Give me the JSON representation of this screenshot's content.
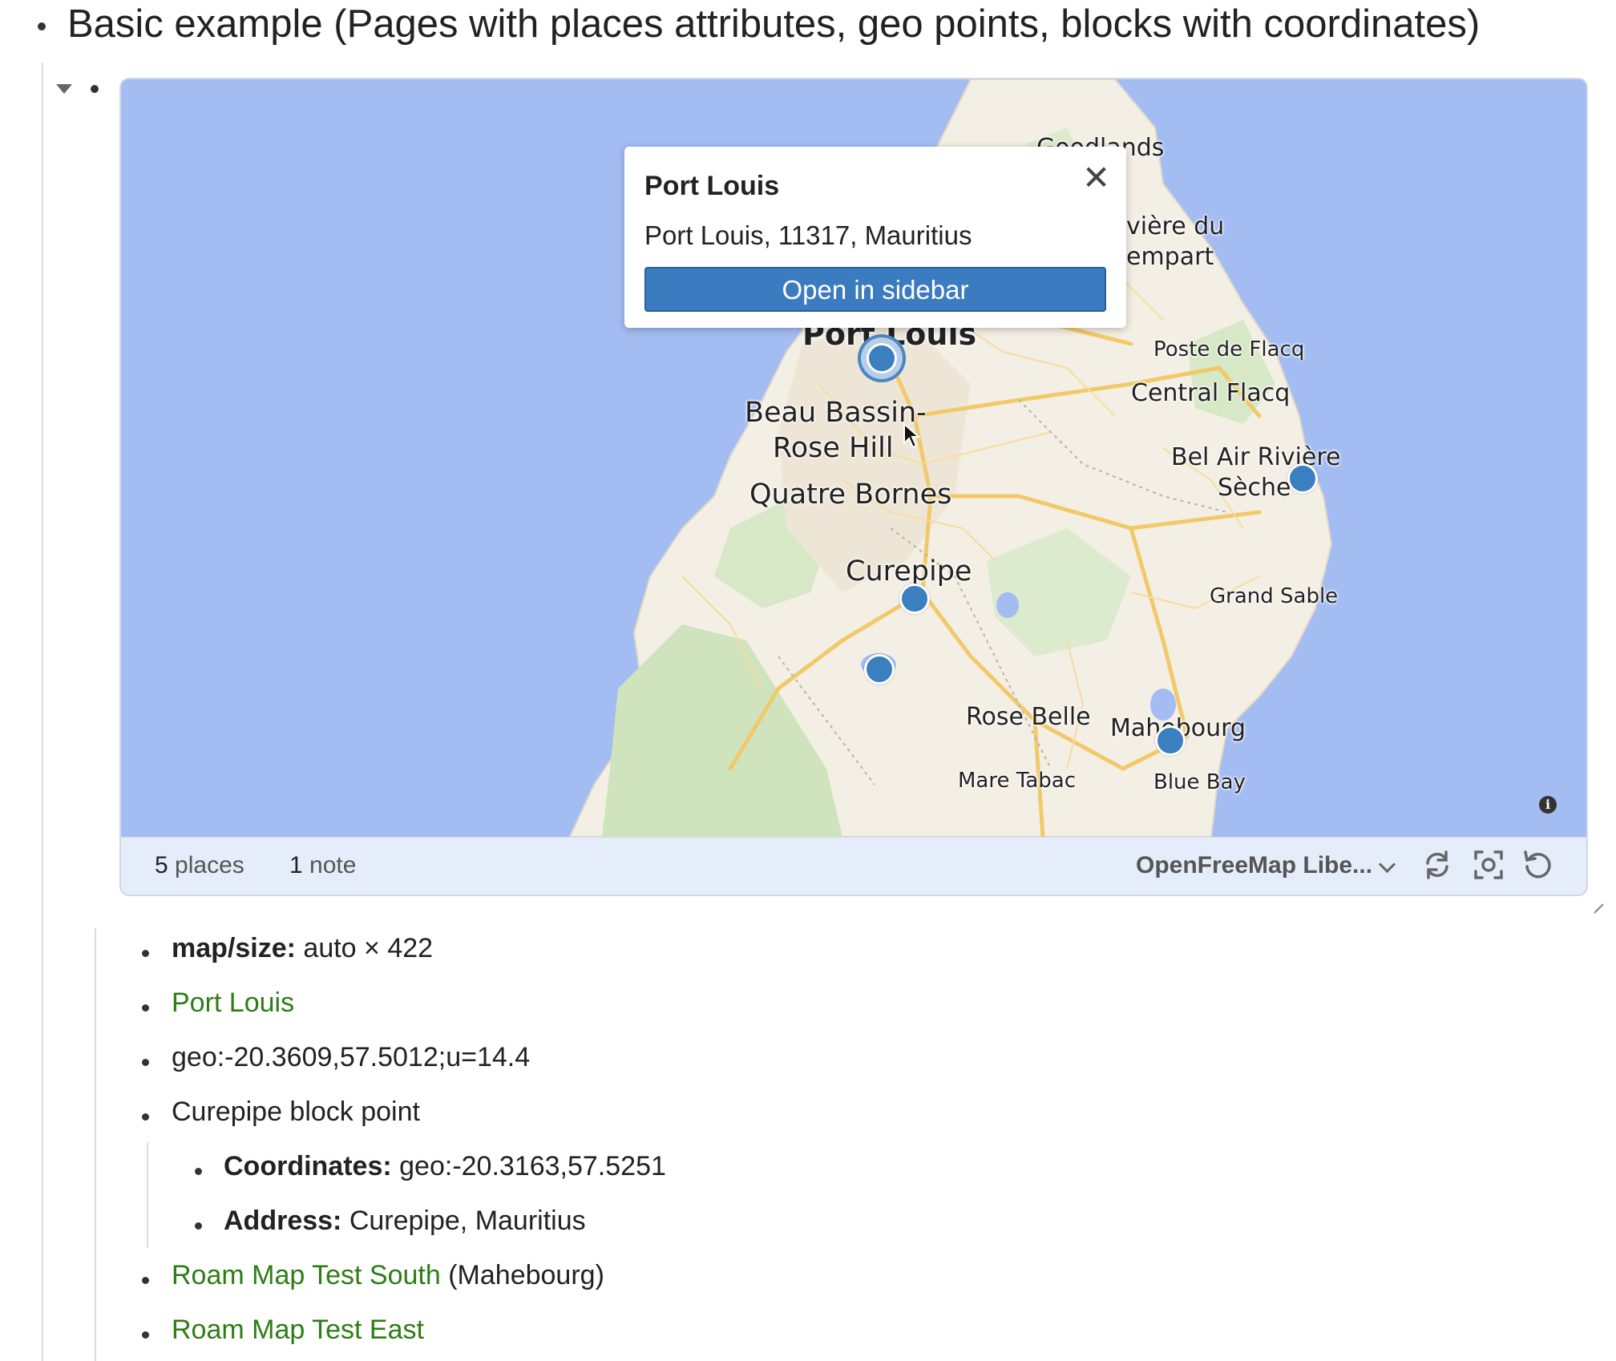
{
  "heading": "Basic example (Pages with places attributes, geo points, blocks with coordinates)",
  "map": {
    "labels": {
      "goodlands": "Goodlands",
      "riviere_du_rempart_1": "vière du",
      "riviere_du_rempart_2": "empart",
      "poste_de_flacq": "Poste de Flacq",
      "central_flacq": "Central Flacq",
      "port_louis": "Port Louis",
      "beau_bassin_1": "Beau Bassin-",
      "beau_bassin_2": "Rose Hill",
      "quatre_bornes": "Quatre Bornes",
      "bel_air_1": "Bel Air Rivière",
      "bel_air_2": "Sèche",
      "curepipe": "Curepipe",
      "grand_sable": "Grand Sable",
      "rose_belle": "Rose Belle",
      "mahebourg": "Mahebourg",
      "mare_tabac": "Mare Tabac",
      "blue_bay": "Blue Bay"
    },
    "popup": {
      "title": "Port Louis",
      "address": "Port Louis, 11317, Mauritius",
      "button": "Open in sidebar",
      "close_icon": "close-icon"
    },
    "footer": {
      "places_count": "5",
      "places_label": "places",
      "notes_count": "1",
      "notes_label": "note",
      "style_selected": "OpenFreeMap Libe...",
      "icons": [
        "refresh-icon",
        "fit-bounds-icon",
        "reset-icon"
      ]
    },
    "colors": {
      "water": "#a3bdf3",
      "land": "#f4efe4",
      "park": "#cfe3bd",
      "road": "#f2c96a",
      "marker": "#3a7fc0",
      "button": "#3b7bbf"
    }
  },
  "properties": {
    "size_key": "map/size:",
    "size_value": "auto × 422"
  },
  "items": {
    "port_louis": "Port Louis",
    "geo": "geo:-20.3609,57.5012;u=14.4",
    "curepipe_block": "Curepipe block point",
    "coordinates_key": "Coordinates:",
    "coordinates_value": "geo:-20.3163,57.5251",
    "address_key": "Address:",
    "address_value": "Curepipe, Mauritius",
    "south_link": "Roam Map Test South",
    "south_suffix": "(Mahebourg)",
    "east_link": "Roam Map Test East"
  }
}
